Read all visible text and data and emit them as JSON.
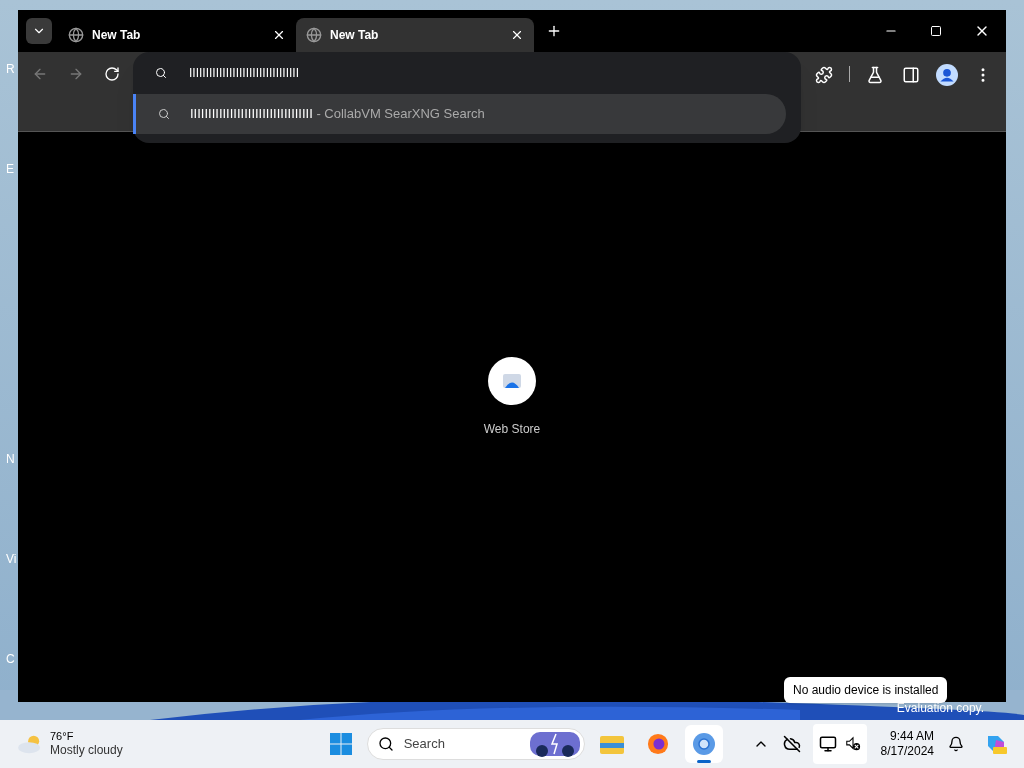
{
  "desktop": {
    "icon_labels": [
      "R",
      "E",
      "N",
      "Vi",
      "C"
    ],
    "watermark": "Evaluation copy."
  },
  "browser": {
    "tabs": [
      {
        "title": "New Tab",
        "selected": false
      },
      {
        "title": "New Tab",
        "selected": true
      }
    ],
    "omnibox": {
      "value": "IIIIIIIIIIIIIIIIIIIIIIIIIIIIIIIII",
      "suggestions": [
        {
          "query": "IIIIIIIIIIIIIIIIIIIIIIIIIIIIIIIIII",
          "source": " - CollabVM SearXNG Search",
          "selected": true
        }
      ]
    },
    "shortcuts": [
      {
        "label": "Web Store"
      }
    ]
  },
  "tooltip": "No audio device is installed",
  "taskbar": {
    "weather": {
      "temperature": "76°F",
      "condition": "Mostly cloudy"
    },
    "search_placeholder": "Search",
    "apps": [
      {
        "kind": "files",
        "active": false
      },
      {
        "kind": "firefox",
        "active": false
      },
      {
        "kind": "chrome",
        "active": true
      }
    ],
    "time": "9:44 AM",
    "date": "8/17/2024"
  }
}
